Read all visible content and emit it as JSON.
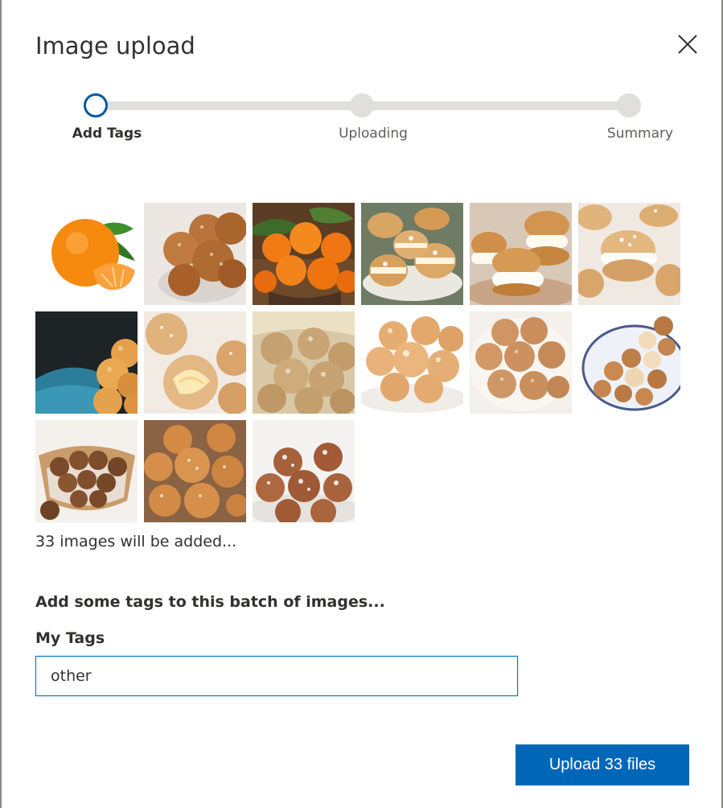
{
  "dialog": {
    "title": "Image upload",
    "close_icon": "close-icon"
  },
  "stepper": {
    "steps": [
      {
        "label": "Add Tags",
        "state": "active"
      },
      {
        "label": "Uploading",
        "state": "pending"
      },
      {
        "label": "Summary",
        "state": "pending"
      }
    ]
  },
  "thumbnails": [
    {
      "subject": "tangerine"
    },
    {
      "subject": "sugared donut holes in glass bowl"
    },
    {
      "subject": "tangerines in basket"
    },
    {
      "subject": "cream puffs"
    },
    {
      "subject": "cream puffs with whipped cream"
    },
    {
      "subject": "cream puffs powdered"
    },
    {
      "subject": "donut holes in blue bowl"
    },
    {
      "subject": "sugared donut hole bitten"
    },
    {
      "subject": "sugared donut holes in paper"
    },
    {
      "subject": "glazed donut holes"
    },
    {
      "subject": "cinnamon donut holes"
    },
    {
      "subject": "donut holes on oval plate"
    },
    {
      "subject": "donut holes in wooden bowl"
    },
    {
      "subject": "sugared donut holes"
    },
    {
      "subject": "powdered donut holes"
    }
  ],
  "summary": {
    "count_text": "33 images will be added..."
  },
  "tags": {
    "heading": "Add some tags to this batch of images...",
    "label": "My Tags",
    "value": "other"
  },
  "actions": {
    "upload_label": "Upload 33 files"
  },
  "colors": {
    "accent": "#0067b8",
    "active_step_ring": "#005a9e",
    "track": "#e1dfdd"
  }
}
